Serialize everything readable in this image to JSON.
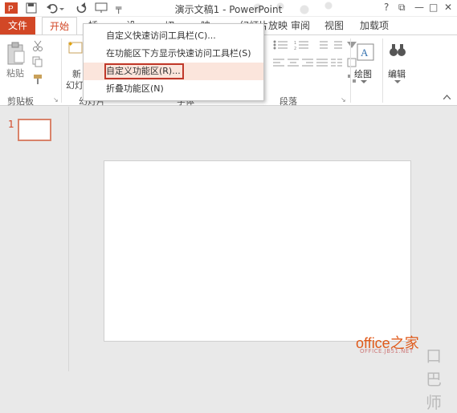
{
  "window": {
    "title": "演示文稿1 - PowerPoint",
    "help": "?",
    "ribbon_options": "⧉",
    "minimize": "—",
    "maximize": "□",
    "close": "✕"
  },
  "qat": {
    "dropdown": "╤"
  },
  "tabs": {
    "file": "文件",
    "home": "开始",
    "review": "审阅",
    "view": "视图",
    "addins": "加载项",
    "partial_1": "插",
    "partial_2": "设",
    "partial_3": "切",
    "partial_4": "映",
    "partial_5": "幻灯片放映"
  },
  "ribbon": {
    "paste_label": "粘贴",
    "new_slide_label_1": "新",
    "new_slide_label_2": "幻灯",
    "drawing_label": "绘图",
    "editing_label": "编辑",
    "groups": {
      "clipboard": "剪贴板",
      "slides": "幻灯片",
      "font": "字体",
      "paragraph": "段落",
      "launcher": "↘"
    }
  },
  "menu": {
    "items": [
      "自定义快速访问工具栏(C)...",
      "在功能区下方显示快速访问工具栏(S)",
      "自定义功能区(R)...",
      "折叠功能区(N)"
    ]
  },
  "slides_panel": {
    "slide_number": "1"
  },
  "watermark": {
    "brand": "office之家",
    "url": "OFFICE.JB51.NET",
    "tail": "口巴师"
  },
  "colors": {
    "accent": "#d24726",
    "highlight": "#fbe5dc",
    "box": "#c0392b"
  }
}
